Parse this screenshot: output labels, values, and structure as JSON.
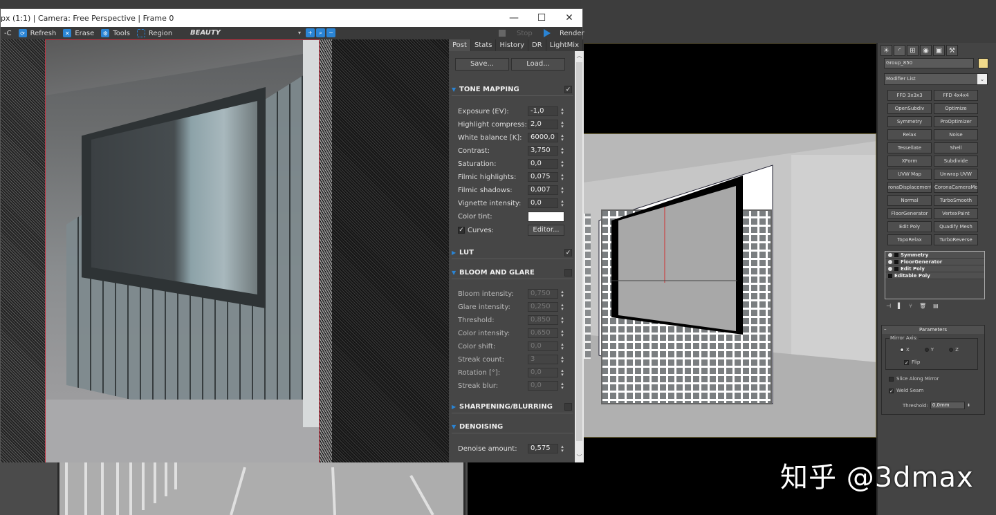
{
  "vfb": {
    "title": "px (1:1) | Camera: Free Perspective | Frame 0",
    "window_controls": {
      "minimize": "—",
      "maximize": "☐",
      "close": "✕"
    },
    "toolbar": {
      "cut_label": "-C",
      "refresh": "Refresh",
      "erase": "Erase",
      "tools": "Tools",
      "region": "Region",
      "channel": "BEAUTY",
      "stop": "Stop",
      "render": "Render"
    },
    "tabs": [
      "Post",
      "Stats",
      "History",
      "DR",
      "LightMix"
    ],
    "active_tab": "Post",
    "post": {
      "save": "Save...",
      "load": "Load...",
      "sections": {
        "tone_mapping": {
          "title": "TONE MAPPING",
          "enabled": true,
          "expanded": true
        },
        "lut": {
          "title": "LUT",
          "enabled": true,
          "expanded": false
        },
        "bloom_glare": {
          "title": "BLOOM AND GLARE",
          "enabled": false,
          "expanded": true
        },
        "sharpening": {
          "title": "SHARPENING/BLURRING",
          "enabled": false,
          "expanded": false
        },
        "denoising": {
          "title": "DENOISING",
          "expanded": true
        }
      },
      "tone_mapping": [
        {
          "label": "Exposure (EV):",
          "value": "-1,0"
        },
        {
          "label": "Highlight compress:",
          "value": "2,0"
        },
        {
          "label": "White balance [K]:",
          "value": "6000,0"
        },
        {
          "label": "Contrast:",
          "value": "3,750"
        },
        {
          "label": "Saturation:",
          "value": "0,0"
        },
        {
          "label": "Filmic highlights:",
          "value": "0,075"
        },
        {
          "label": "Filmic shadows:",
          "value": "0,007"
        },
        {
          "label": "Vignette intensity:",
          "value": "0,0"
        }
      ],
      "color_tint_label": "Color tint:",
      "color_tint": "#ffffff",
      "curves_label": "Curves:",
      "curves_enabled": true,
      "editor": "Editor...",
      "bloom_glare": [
        {
          "label": "Bloom intensity:",
          "value": "0,750"
        },
        {
          "label": "Glare intensity:",
          "value": "0,250"
        },
        {
          "label": "Threshold:",
          "value": "0,850"
        },
        {
          "label": "Color intensity:",
          "value": "0,650"
        },
        {
          "label": "Color shift:",
          "value": "0,0"
        },
        {
          "label": "Streak count:",
          "value": "3"
        },
        {
          "label": "Rotation [°]:",
          "value": "0,0"
        },
        {
          "label": "Streak blur:",
          "value": "0,0"
        }
      ],
      "denoise": {
        "label": "Denoise amount:",
        "value": "0,575"
      }
    }
  },
  "command_panel": {
    "tab_icons": [
      "create-icon",
      "modify-icon",
      "hierarchy-icon",
      "motion-icon",
      "display-icon",
      "utilities-icon"
    ],
    "object_name": "Group_850",
    "object_color": "#f0d98a",
    "modifier_list": "Modifier List",
    "modifier_buttons": [
      "FFD 3x3x3",
      "FFD 4x4x4",
      "OpenSubdiv",
      "Optimize",
      "Symmetry",
      "ProOptimizer",
      "Relax",
      "Noise",
      "Tessellate",
      "Shell",
      "XForm",
      "Subdivide",
      "UVW Map",
      "Unwrap UVW",
      "ronaDisplacementM",
      "CoronaCameraMod",
      "Normal",
      "TurboSmooth",
      "FloorGenerator",
      "VertexPaint",
      "Edit Poly",
      "Quadify Mesh",
      "TopoRelax",
      "TurboReverse"
    ],
    "stack": [
      "Symmetry",
      "FloorGenerator",
      "Edit Poly",
      "Editable Poly"
    ],
    "parameters": {
      "title": "Parameters",
      "mirror_axis": "Mirror Axis:",
      "axes": [
        "X",
        "Y",
        "Z"
      ],
      "selected_axis": "X",
      "flip": "Flip",
      "flip_checked": true,
      "slice_along_mirror": "Slice Along Mirror",
      "slice_checked": false,
      "weld_seam": "Weld Seam",
      "weld_checked": true,
      "threshold_label": "Threshold:",
      "threshold_value": "0,0mm"
    }
  },
  "watermark": "知乎 @3dmax",
  "accent_color": "#2a84d4"
}
